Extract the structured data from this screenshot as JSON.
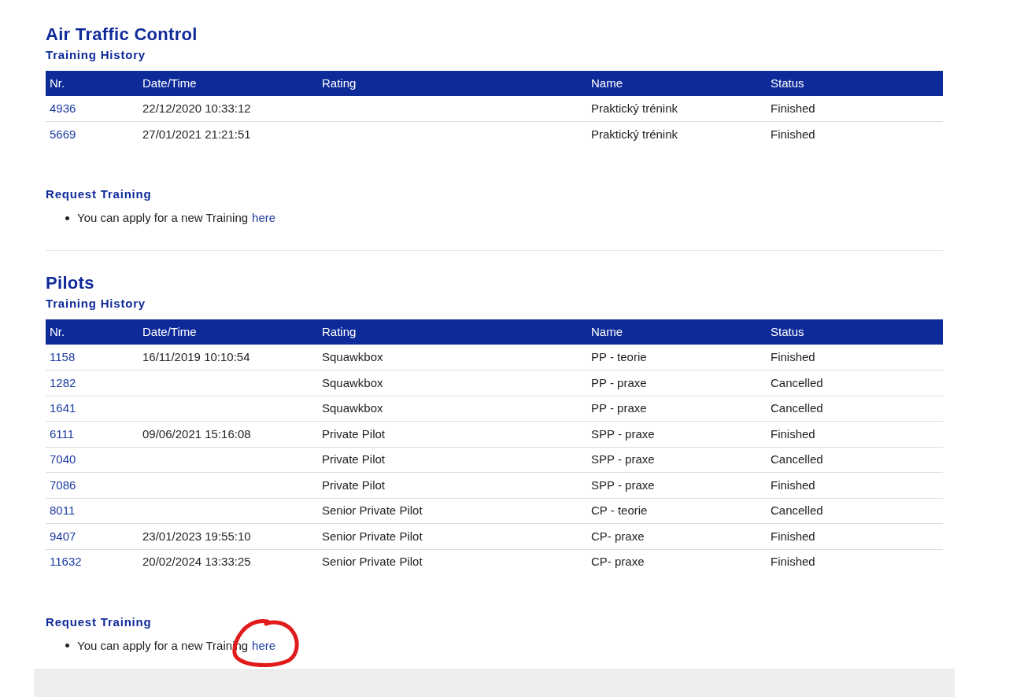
{
  "sections": [
    {
      "title": "Air Traffic Control",
      "history_title": "Training History",
      "columns": [
        "Nr.",
        "Date/Time",
        "Rating",
        "Name",
        "Status"
      ],
      "rows": [
        [
          "4936",
          "22/12/2020 10:33:12",
          "",
          "Praktický trénink",
          "Finished"
        ],
        [
          "5669",
          "27/01/2021 21:21:51",
          "",
          "Praktický trénink",
          "Finished"
        ]
      ],
      "request": {
        "title": "Request Training",
        "text": "You can apply for a new Training",
        "link": "here",
        "annotated": false
      }
    },
    {
      "title": "Pilots",
      "history_title": "Training History",
      "columns": [
        "Nr.",
        "Date/Time",
        "Rating",
        "Name",
        "Status"
      ],
      "rows": [
        [
          "1158",
          "16/11/2019 10:10:54",
          "Squawkbox",
          "PP - teorie",
          "Finished"
        ],
        [
          "1282",
          "",
          "Squawkbox",
          "PP - praxe",
          "Cancelled"
        ],
        [
          "1641",
          "",
          "Squawkbox",
          "PP - praxe",
          "Cancelled"
        ],
        [
          "6111",
          "09/06/2021 15:16:08",
          "Private Pilot",
          "SPP - praxe",
          "Finished"
        ],
        [
          "7040",
          "",
          "Private Pilot",
          "SPP - praxe",
          "Cancelled"
        ],
        [
          "7086",
          "",
          "Private Pilot",
          "SPP - praxe",
          "Finished"
        ],
        [
          "8011",
          "",
          "Senior Private Pilot",
          "CP - teorie",
          "Cancelled"
        ],
        [
          "9407",
          "23/01/2023 19:55:10",
          "Senior Private Pilot",
          "CP- praxe",
          "Finished"
        ],
        [
          "11632",
          "20/02/2024 13:33:25",
          "Senior Private Pilot",
          "CP- praxe",
          "Finished"
        ]
      ],
      "request": {
        "title": "Request Training",
        "text": "You can apply for a new Training",
        "link": "here",
        "annotated": true
      }
    }
  ]
}
